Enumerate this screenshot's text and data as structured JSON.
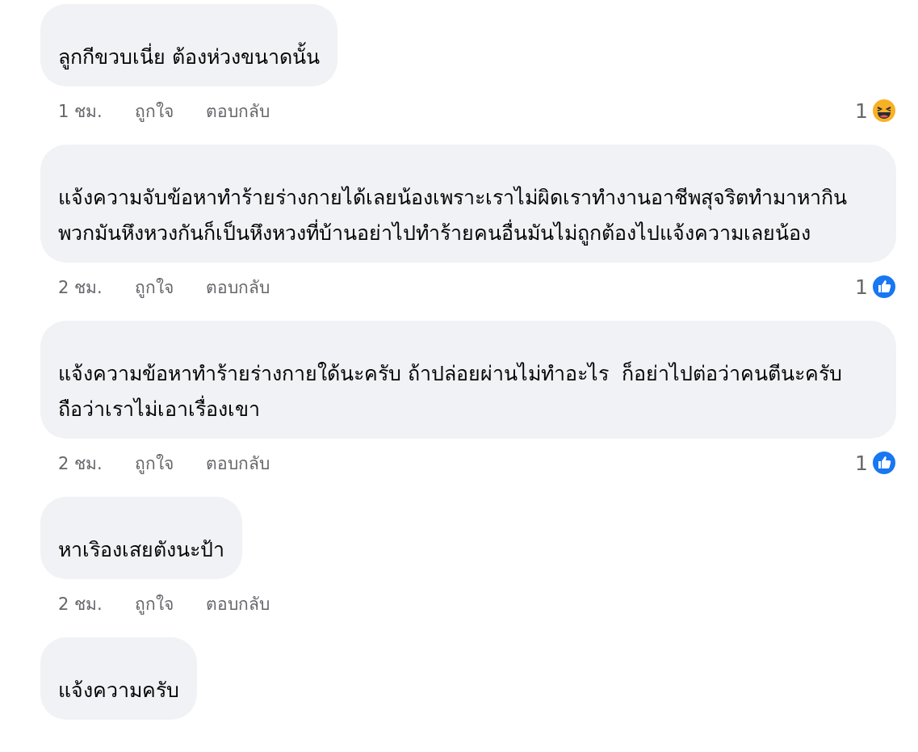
{
  "comments": [
    {
      "text": "ลูกกีขวบเนี่ย ต้องห่วงขนาดนั้น",
      "time": "1 ชม.",
      "like": "ถูกใจ",
      "reply": "ตอบกลับ",
      "reaction": {
        "kind": "haha",
        "count": "1"
      }
    },
    {
      "text": "แจ้งความจับข้อหาทำร้ายร่างกายได้เลยน้องเพราะเราไม่ผิดเราทำงานอาชีพสุจริตทำมาหากินพวกมันหึงหวงกันก็เป็นหึงหวงที่บ้านอย่าไปทำร้ายคนอื่นมันไม่ถูกต้องไปแจ้งความเลยน้อง",
      "time": "2 ชม.",
      "like": "ถูกใจ",
      "reply": "ตอบกลับ",
      "reaction": {
        "kind": "like",
        "count": "1"
      }
    },
    {
      "text": "แจ้งความข้อหาทำร้ายร่างกายใด้นะครับ ถ้าปล่อยผ่านไม่ทำอะไร  ก็อย่าไปต่อว่าคนตีนะครับถือว่าเราไม่เอาเรื่องเขา",
      "time": "2 ชม.",
      "like": "ถูกใจ",
      "reply": "ตอบกลับ",
      "reaction": {
        "kind": "like",
        "count": "1"
      }
    },
    {
      "text": "หาเริองเสยตังนะป้า",
      "time": "2 ชม.",
      "like": "ถูกใจ",
      "reply": "ตอบกลับ"
    },
    {
      "text": "แจ้งความครับ"
    }
  ]
}
